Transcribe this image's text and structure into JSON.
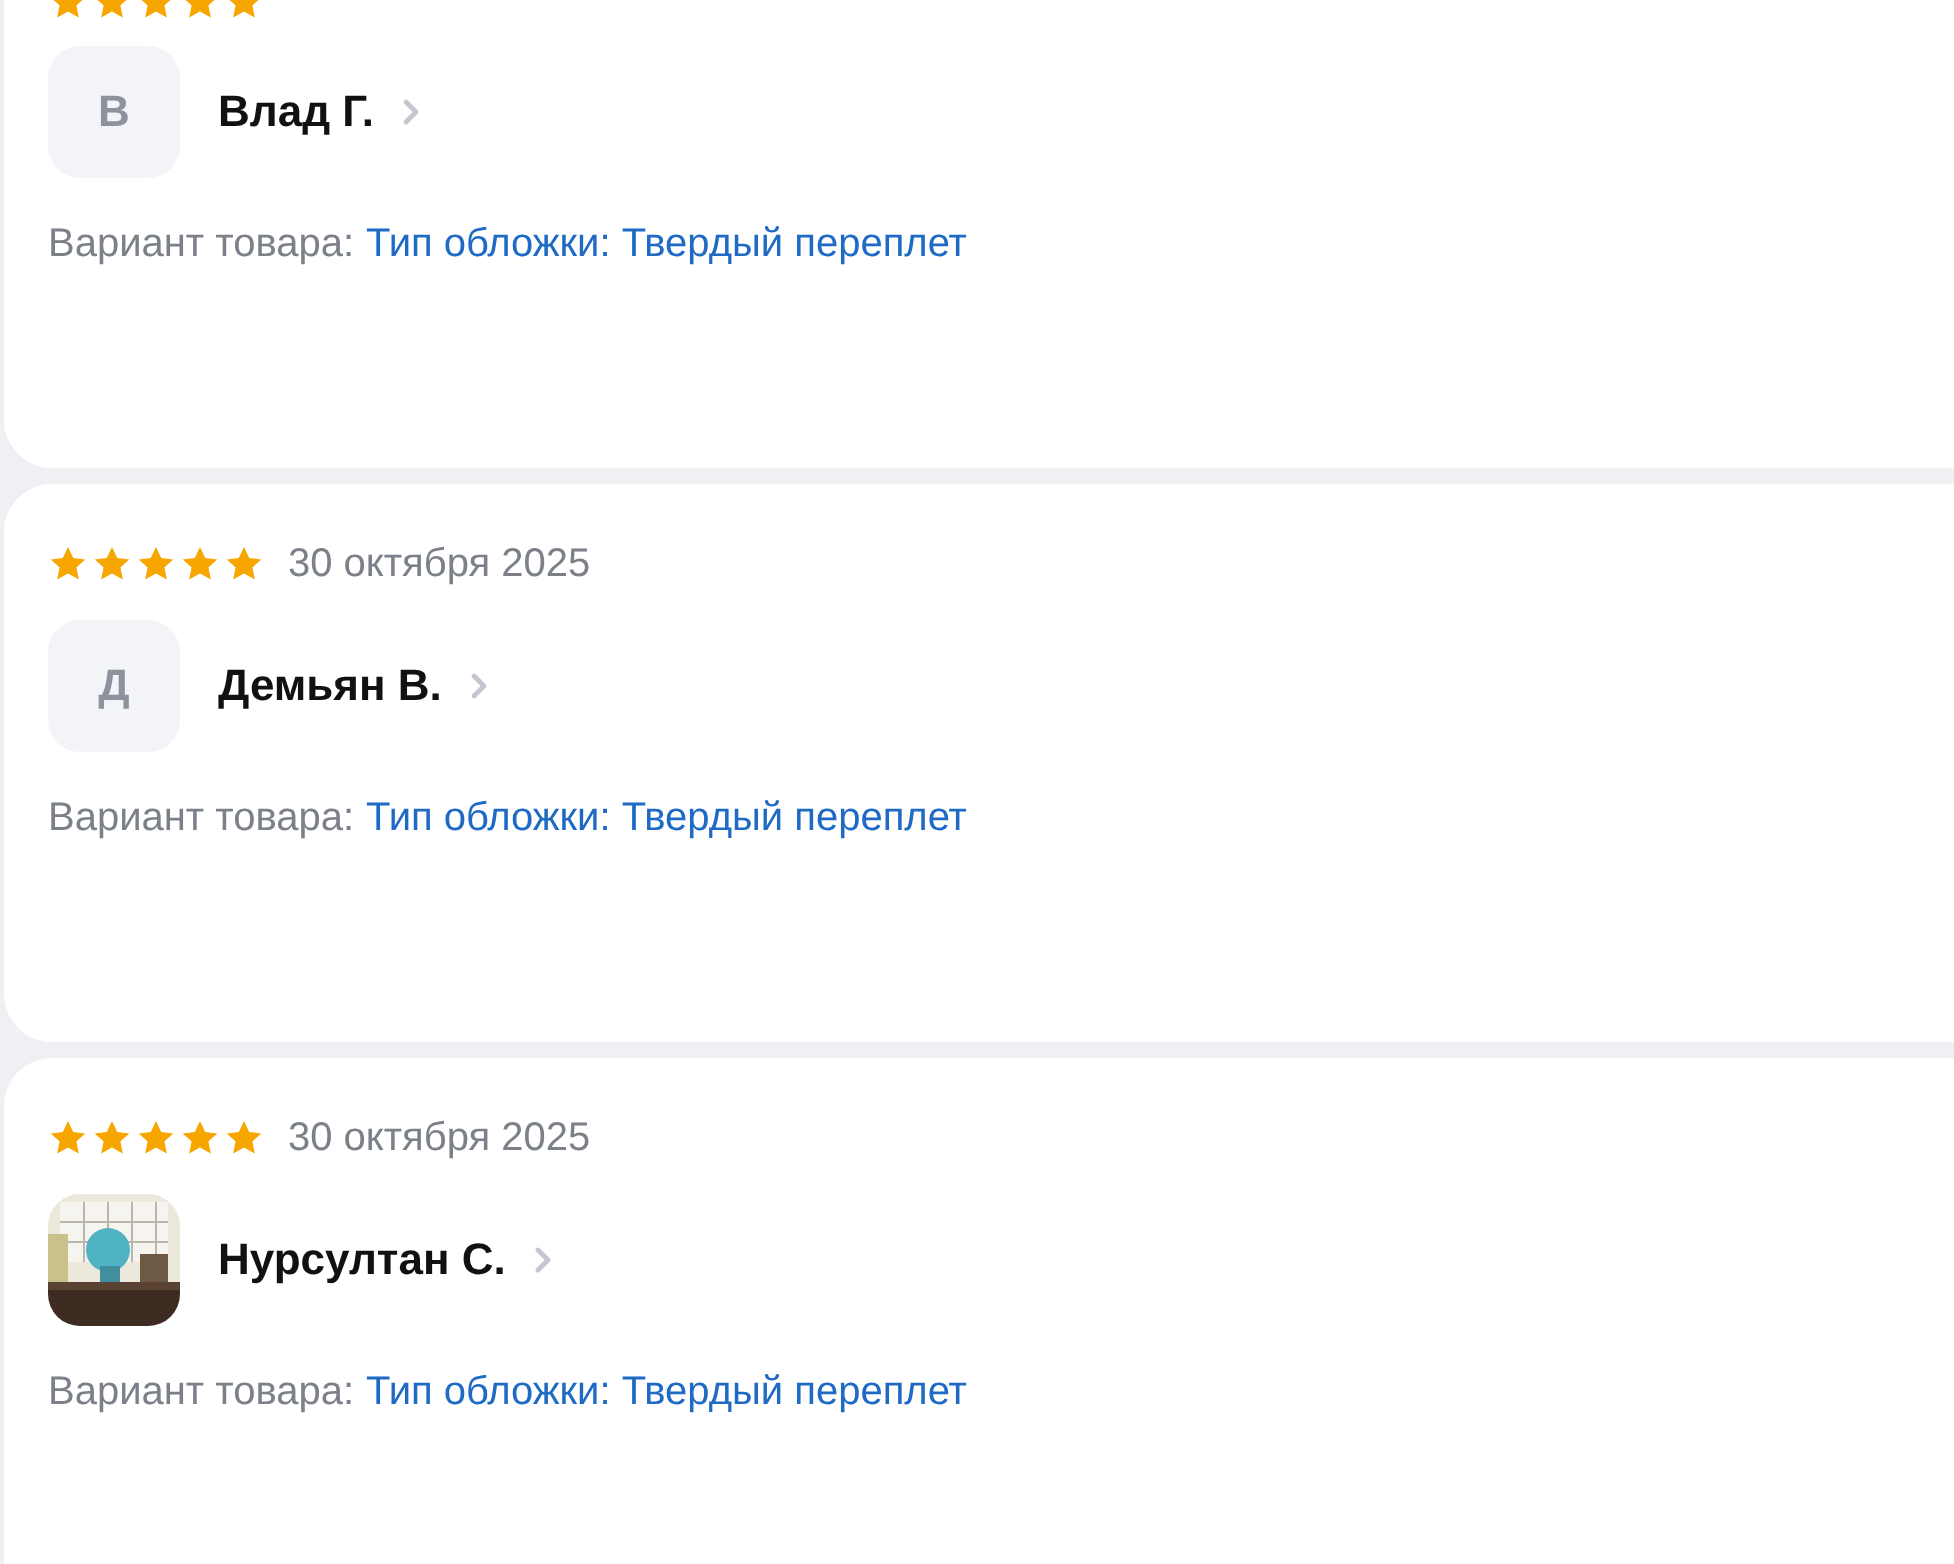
{
  "reviews": [
    {
      "stars": 5,
      "avatar": {
        "kind": "letter",
        "letter": "В"
      },
      "name": "Влад Г.",
      "variant_label": "Вариант товара:",
      "variant_value": "Тип обложки: Твердый переплет"
    },
    {
      "stars": 5,
      "date": "30 октября 2025",
      "avatar": {
        "kind": "letter",
        "letter": "Д"
      },
      "name": "Демьян В.",
      "variant_label": "Вариант товара:",
      "variant_value": "Тип обложки: Твердый переплет"
    },
    {
      "stars": 5,
      "date": "30 октября 2025",
      "name": "Нурсултан С.",
      "variant_label": "Вариант товара:",
      "variant_value": "Тип обложки: Твердый переплет"
    }
  ]
}
